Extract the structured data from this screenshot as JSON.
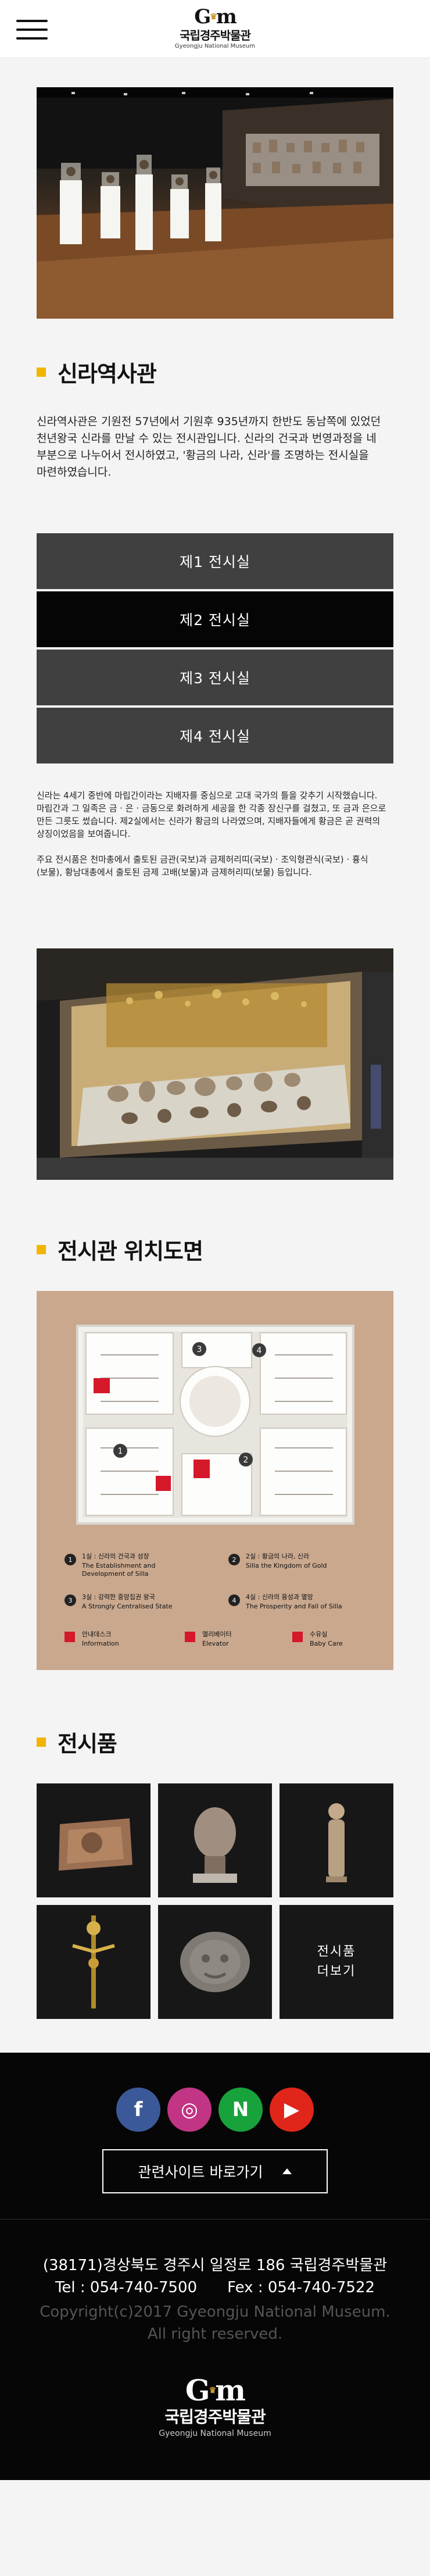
{
  "header": {
    "logo_mark": "G",
    "logo_name": "국립경주박물관",
    "logo_en": "Gyeongju National Museum"
  },
  "silla": {
    "title": "신라역사관",
    "intro": "신라역사관은 기원전 57년에서 기원후 935년까지 한반도 동남쪽에 있었던 천년왕국 신라를 만날 수 있는 전시관입니다. 신라의 건국과 번영과정을 네 부분으로 나누어서 전시하였고, '황금의 나라, 신라'를 조명하는 전시실을 마련하였습니다.",
    "gallery_menu": [
      "제1 전시실",
      "제2 전시실",
      "제3 전시실",
      "제4 전시실"
    ],
    "active_index": 1,
    "desc_1": "신라는 4세기 중반에 마립간이라는 지배자를 중심으로 고대 국가의 틀을 갖추기 시작했습니다. 마립간과 그 일족은 금 · 은 · 금동으로 화려하게 세공을 한 각종 장신구를 걸쳤고, 또 금과 은으로 만든 그릇도 썼습니다. 제2실에서는 신라가 황금의 나라였으며, 지배자들에게 황금은 곧 권력의 상징이었음을 보여줍니다.",
    "desc_2": "주요 전시품은 천마총에서 출토된 금관(국보)과 금제허리띠(국보) · 조익형관식(국보) · 흉식(보물), 황남대총에서 출토된 금제 고배(보물)과 금제허리띠(보물) 등입니다."
  },
  "location": {
    "title": "전시관 위치도면",
    "legend": [
      {
        "num": "1",
        "ko": "1실 : 신라의 건국과 성장",
        "en1": "The Establishment and",
        "en2": "Development of Silla"
      },
      {
        "num": "2",
        "ko": "2실 : 황금의 나라, 신라",
        "en1": "Silla the Kingdom of Gold",
        "en2": ""
      },
      {
        "num": "3",
        "ko": "3실 : 강력한 중앙집권 왕국",
        "en1": "A Strongly Centralised State",
        "en2": ""
      },
      {
        "num": "4",
        "ko": "4실 : 신라의 융성과 멸망",
        "en1": "The Prosperity and Fall of Silla",
        "en2": ""
      }
    ],
    "facilities": [
      {
        "ko": "안내데스크",
        "en": "Information"
      },
      {
        "ko": "엘리베이터",
        "en": "Elevator"
      },
      {
        "ko": "수유실",
        "en": "Baby Care"
      }
    ],
    "map_labels": [
      "1",
      "2",
      "3",
      "4"
    ]
  },
  "exhibits": {
    "title": "전시품",
    "more_line1": "전시품",
    "more_line2": "더보기"
  },
  "footer": {
    "social": [
      {
        "name": "facebook-icon",
        "glyph": "f",
        "color": "#3b5998"
      },
      {
        "name": "instagram-icon",
        "glyph": "◎",
        "color": "#c13584"
      },
      {
        "name": "naver-icon",
        "glyph": "N",
        "color": "#18a23b"
      },
      {
        "name": "youtube-icon",
        "glyph": "▶",
        "color": "#e0261a"
      }
    ],
    "related_label": "관련사이트 바로가기",
    "address": "(38171)경상북도 경주시 일정로 186 국립경주박물관",
    "tel": "Tel : 054-740-7500",
    "fax": "Fex : 054-740-7522",
    "copyright_1": "Copyright(c)2017 Gyeongju National Museum.",
    "copyright_2": "All right reserved.",
    "logo_mark": "G",
    "logo_name": "국립경주박물관",
    "logo_en": "Gyeongju National Museum"
  }
}
